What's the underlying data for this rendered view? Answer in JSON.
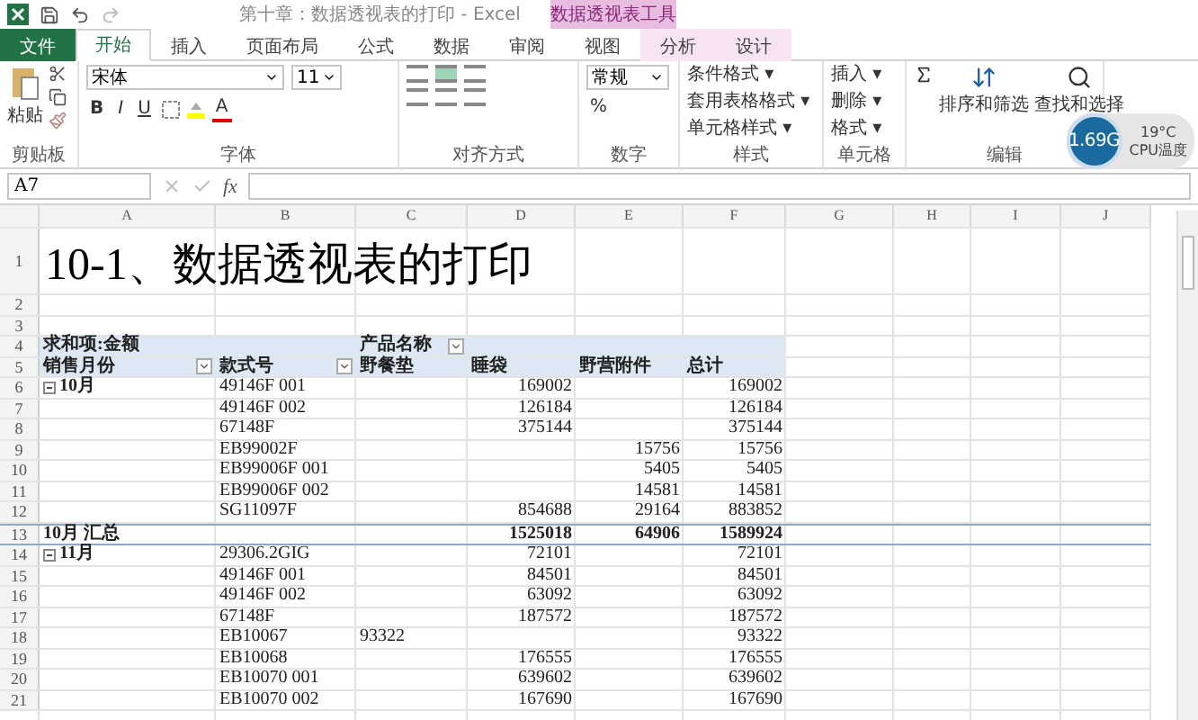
{
  "window": {
    "title": "第十章：数据透视表的打印 - Excel",
    "context_tab_group": "数据透视表工具"
  },
  "tabs": [
    {
      "label": "文件",
      "kind": "file",
      "selected": false
    },
    {
      "label": "开始",
      "kind": "normal",
      "selected": true
    },
    {
      "label": "插入",
      "kind": "normal",
      "selected": false
    },
    {
      "label": "页面布局",
      "kind": "normal",
      "selected": false
    },
    {
      "label": "公式",
      "kind": "normal",
      "selected": false
    },
    {
      "label": "数据",
      "kind": "normal",
      "selected": false
    },
    {
      "label": "审阅",
      "kind": "normal",
      "selected": false
    },
    {
      "label": "视图",
      "kind": "normal",
      "selected": false
    },
    {
      "label": "分析",
      "kind": "context",
      "selected": false
    },
    {
      "label": "设计",
      "kind": "context",
      "selected": false
    }
  ],
  "ribbon": {
    "paste_label": "粘贴",
    "font_name": "宋体",
    "font_size": "11",
    "bold": "B",
    "italic": "I",
    "underline": "U",
    "font_color": "A",
    "number_format": "常规",
    "percent": "%",
    "styles": [
      "条件格式 ▾",
      "套用表格格式 ▾",
      "单元格样式 ▾"
    ],
    "cells": [
      "插入 ▾",
      "删除 ▾",
      "格式 ▾"
    ],
    "sort_label": "排序和筛选",
    "find_label": "查找和选择",
    "groups": [
      "剪贴板",
      "字体",
      "对齐方式",
      "数字",
      "样式",
      "单元格",
      "编辑"
    ]
  },
  "cpu_widget": {
    "speed": "1.69G",
    "temperature": "19°C",
    "caption": "CPU温度"
  },
  "formula_bar": {
    "name_box": "A7",
    "fx": "fx"
  },
  "sheet": {
    "columns": [
      "A",
      "B",
      "C",
      "D",
      "E",
      "F",
      "G",
      "H",
      "I",
      "J"
    ],
    "rows": [
      {
        "num": "1",
        "kind": "title",
        "cells": [
          "10-1、数据透视表的打印"
        ]
      },
      {
        "num": "2",
        "kind": "blank",
        "cells": []
      },
      {
        "num": "3",
        "kind": "blank",
        "cells": []
      },
      {
        "num": "4",
        "kind": "header",
        "cells": [
          "求和项:金额",
          "",
          "产品名称",
          "",
          "",
          ""
        ],
        "dropdowns": [
          false,
          false,
          true,
          false,
          false,
          false
        ]
      },
      {
        "num": "5",
        "kind": "header",
        "cells": [
          "销售月份",
          "款式号",
          "野餐垫",
          "睡袋",
          "野营附件",
          "总计"
        ],
        "dropdowns": [
          true,
          true,
          false,
          false,
          false,
          false
        ]
      },
      {
        "num": "6",
        "kind": "group",
        "expanded": true,
        "cells": [
          "10月",
          "49146F 001",
          "",
          "169002",
          "",
          "169002"
        ]
      },
      {
        "num": "7",
        "kind": "data",
        "cells": [
          "",
          "49146F 002",
          "",
          "126184",
          "",
          "126184"
        ]
      },
      {
        "num": "8",
        "kind": "data",
        "cells": [
          "",
          "67148F",
          "",
          "375144",
          "",
          "375144"
        ]
      },
      {
        "num": "9",
        "kind": "data",
        "cells": [
          "",
          "EB99002F",
          "",
          "",
          "15756",
          "15756"
        ]
      },
      {
        "num": "10",
        "kind": "data",
        "cells": [
          "",
          "EB99006F 001",
          "",
          "",
          "5405",
          "5405"
        ]
      },
      {
        "num": "11",
        "kind": "data",
        "cells": [
          "",
          "EB99006F 002",
          "",
          "",
          "14581",
          "14581"
        ]
      },
      {
        "num": "12",
        "kind": "data",
        "cells": [
          "",
          "SG11097F",
          "",
          "854688",
          "29164",
          "883852"
        ]
      },
      {
        "num": "13",
        "kind": "subtotal",
        "cells": [
          "10月 汇总",
          "",
          "",
          "1525018",
          "64906",
          "1589924"
        ]
      },
      {
        "num": "14",
        "kind": "group",
        "expanded": true,
        "cells": [
          "11月",
          "29306.2GIG",
          "",
          "72101",
          "",
          "72101"
        ]
      },
      {
        "num": "15",
        "kind": "data",
        "cells": [
          "",
          "49146F 001",
          "",
          "84501",
          "",
          "84501"
        ]
      },
      {
        "num": "16",
        "kind": "data",
        "cells": [
          "",
          "49146F 002",
          "",
          "63092",
          "",
          "63092"
        ]
      },
      {
        "num": "17",
        "kind": "data",
        "cells": [
          "",
          "67148F",
          "",
          "187572",
          "",
          "187572"
        ]
      },
      {
        "num": "18",
        "kind": "data",
        "cells": [
          "",
          "EB10067",
          "93322",
          "",
          "",
          "93322"
        ]
      },
      {
        "num": "19",
        "kind": "data",
        "cells": [
          "",
          "EB10068",
          "",
          "176555",
          "",
          "176555"
        ]
      },
      {
        "num": "20",
        "kind": "data",
        "cells": [
          "",
          "EB10070 001",
          "",
          "639602",
          "",
          "639602"
        ]
      },
      {
        "num": "21",
        "kind": "data",
        "cells": [
          "",
          "EB10070 002",
          "",
          "167690",
          "",
          "167690"
        ]
      }
    ]
  }
}
